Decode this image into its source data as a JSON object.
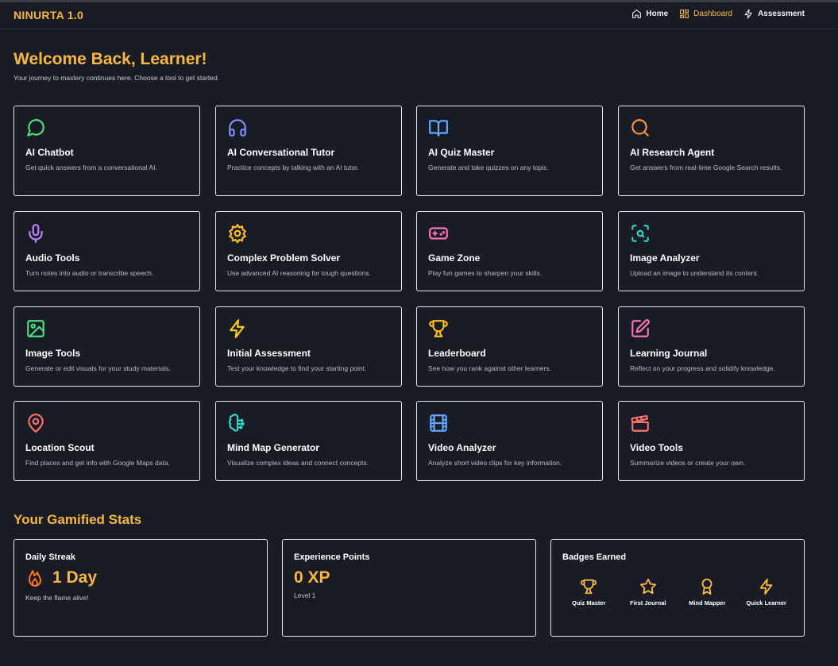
{
  "app": {
    "brand": "NINURTA 1.0"
  },
  "nav": [
    {
      "label": "Home",
      "icon": "home-icon"
    },
    {
      "label": "Dashboard",
      "icon": "dashboard-icon"
    },
    {
      "label": "Assessment",
      "icon": "bolt-icon"
    }
  ],
  "hero": {
    "title": "Welcome Back, Learner!",
    "subtitle": "Your journey to mastery continues here. Choose a tool to get started."
  },
  "tools": [
    {
      "title": "AI Chatbot",
      "desc": "Get quick answers from a conversational AI.",
      "icon": "chat-icon",
      "color": "#4ade80"
    },
    {
      "title": "AI Conversational Tutor",
      "desc": "Practice concepts by talking with an AI tutor.",
      "icon": "headphones-icon",
      "color": "#818cf8"
    },
    {
      "title": "AI Quiz Master",
      "desc": "Generate and take quizzes on any topic.",
      "icon": "book-icon",
      "color": "#60a5fa"
    },
    {
      "title": "AI Research Agent",
      "desc": "Get answers from real-time Google Search results.",
      "icon": "search-icon",
      "color": "#fb923c"
    },
    {
      "title": "Audio Tools",
      "desc": "Turn notes into audio or transcribe speech.",
      "icon": "microphone-icon",
      "color": "#c084fc"
    },
    {
      "title": "Complex Problem Solver",
      "desc": "Use advanced AI reasoning for tough questions.",
      "icon": "cog-icon",
      "color": "#fbbf24"
    },
    {
      "title": "Game Zone",
      "desc": "Play fun games to sharpen your skills.",
      "icon": "gamepad-icon",
      "color": "#f472b6"
    },
    {
      "title": "Image Analyzer",
      "desc": "Upload an image to understand its content.",
      "icon": "scan-search-icon",
      "color": "#2dd4bf"
    },
    {
      "title": "Image Tools",
      "desc": "Generate or edit visuals for your study materials.",
      "icon": "image-icon",
      "color": "#4ade80"
    },
    {
      "title": "Initial Assessment",
      "desc": "Test your knowledge to find your starting point.",
      "icon": "bolt-icon",
      "color": "#facc15"
    },
    {
      "title": "Leaderboard",
      "desc": "See how you rank against other learners.",
      "icon": "trophy-icon",
      "color": "#fbbf24"
    },
    {
      "title": "Learning Journal",
      "desc": "Reflect on your progress and solidify knowledge.",
      "icon": "pencil-square-icon",
      "color": "#f472b6"
    },
    {
      "title": "Location Scout",
      "desc": "Find places and get info with Google Maps data.",
      "icon": "map-pin-icon",
      "color": "#f87171"
    },
    {
      "title": "Mind Map Generator",
      "desc": "Visualize complex ideas and connect concepts.",
      "icon": "brain-icon",
      "color": "#2dd4bf"
    },
    {
      "title": "Video Analyzer",
      "desc": "Analyze short video clips for key information.",
      "icon": "film-icon",
      "color": "#60a5fa"
    },
    {
      "title": "Video Tools",
      "desc": "Summarize videos or create your own.",
      "icon": "clapperboard-icon",
      "color": "#f87171"
    }
  ],
  "stats": {
    "title": "Your Gamified Stats",
    "streak": {
      "label": "Daily Streak",
      "value": "1 Day",
      "note": "Keep the flame alive!"
    },
    "xp": {
      "label": "Experience Points",
      "value": "0 XP",
      "level": "Level 1"
    },
    "badges": {
      "label": "Badges Earned",
      "items": [
        {
          "name": "Quiz Master",
          "icon": "trophy-icon"
        },
        {
          "name": "First Journal",
          "icon": "star-icon"
        },
        {
          "name": "Mind Mapper",
          "icon": "award-icon"
        },
        {
          "name": "Quick Learner",
          "icon": "bolt-icon"
        }
      ]
    }
  },
  "colors": {
    "accent": "#f5b83d",
    "background": "#1a1c25",
    "card_border": "#e5e5ea"
  }
}
